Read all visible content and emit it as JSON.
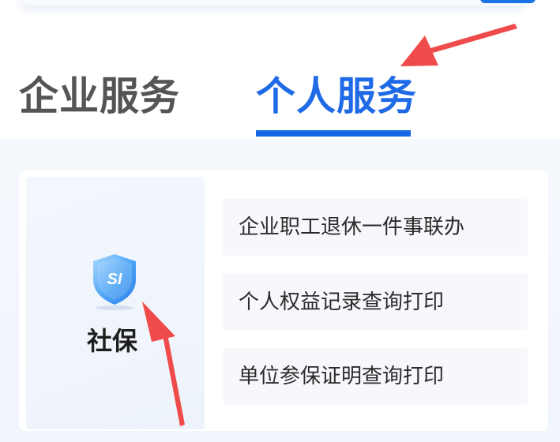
{
  "tabs": [
    {
      "label": "企业服务",
      "active": false
    },
    {
      "label": "个人服务",
      "active": true
    }
  ],
  "category": {
    "label": "社保",
    "icon": "shield-si-icon",
    "icon_text": "SI"
  },
  "services": [
    {
      "label": "企业职工退休一件事联办"
    },
    {
      "label": "个人权益记录查询打印"
    },
    {
      "label": "单位参保证明查询打印"
    }
  ],
  "colors": {
    "accent": "#1667e6",
    "annotation": "#f04b4b",
    "inactive_tab": "#555555"
  }
}
